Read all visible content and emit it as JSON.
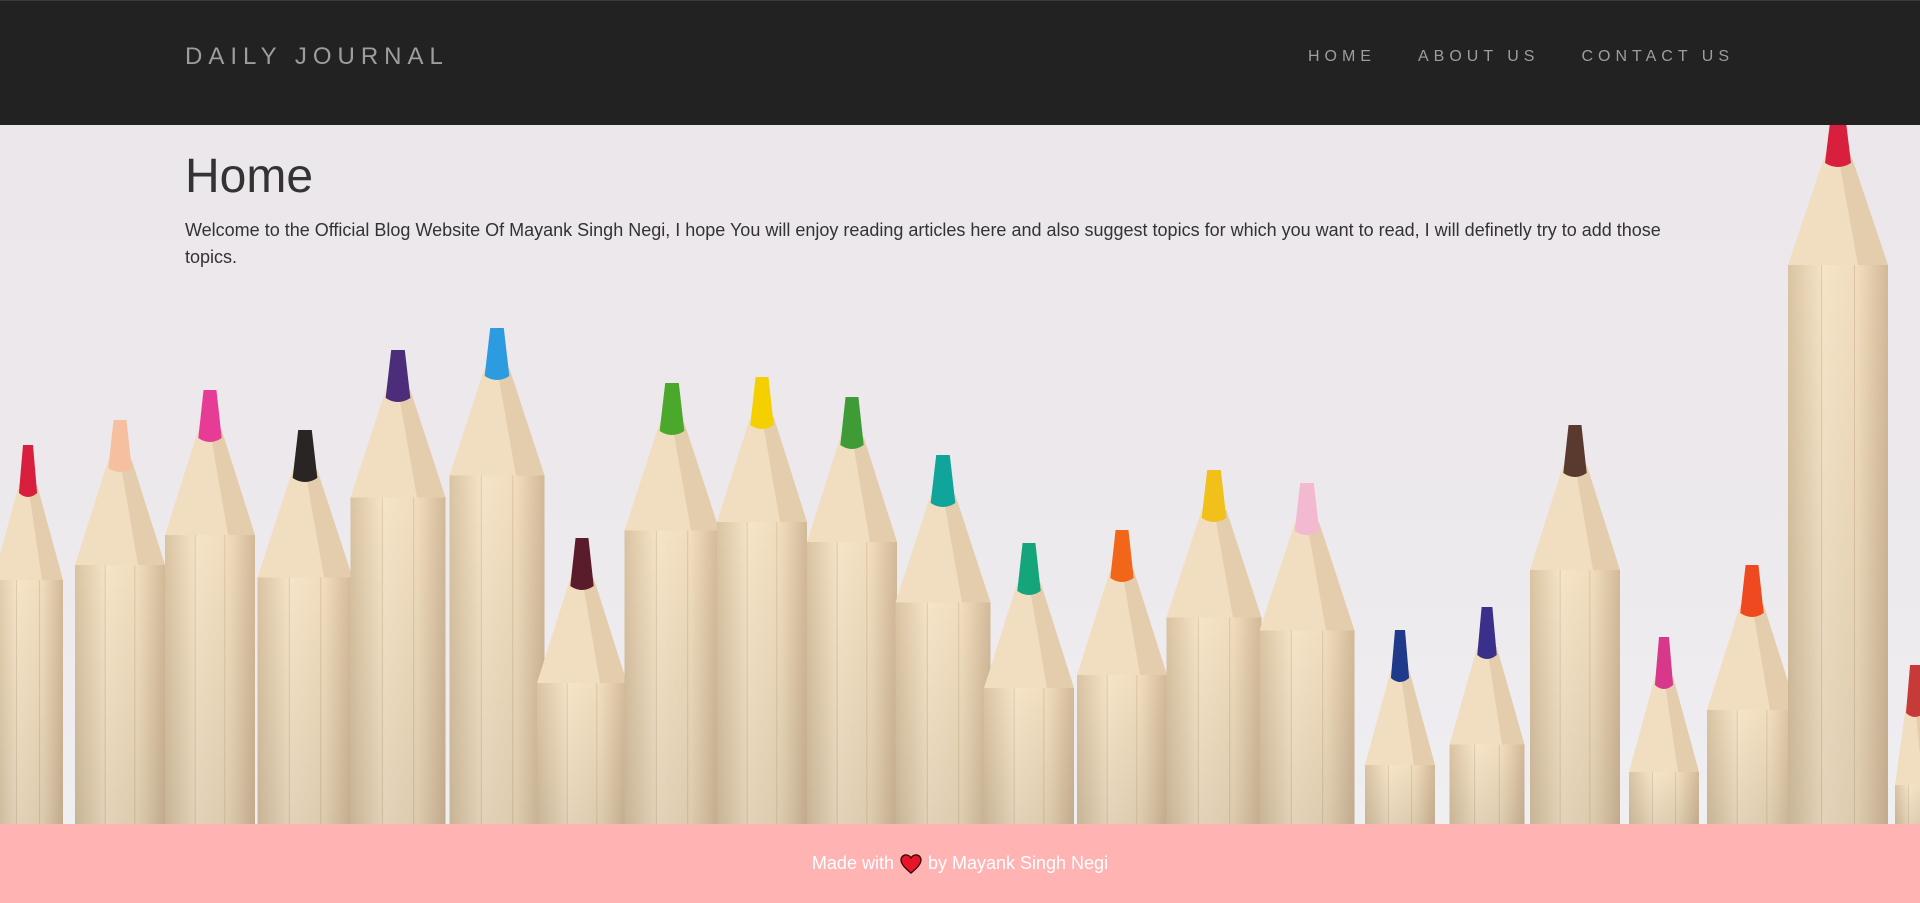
{
  "navbar": {
    "brand": "DAILY JOURNAL",
    "links": [
      {
        "label": "HOME"
      },
      {
        "label": "ABOUT US"
      },
      {
        "label": "CONTACT US"
      }
    ]
  },
  "main": {
    "title": "Home",
    "intro": "Welcome to the Official Blog Website Of Mayank Singh Negi, I hope You will enjoy reading articles here and also suggest topics for which you want to read, I will definetly try to add those topics."
  },
  "footer": {
    "text_before": "Made with",
    "icon": "heart-icon",
    "text_after": "by Mayank Singh Negi"
  },
  "colors": {
    "navbar_bg": "#222222",
    "nav_text": "#9d9d9d",
    "footer_bg": "#ffb3b3",
    "heart": "#e8142a"
  },
  "hero_background": "colored-pencils-photo"
}
